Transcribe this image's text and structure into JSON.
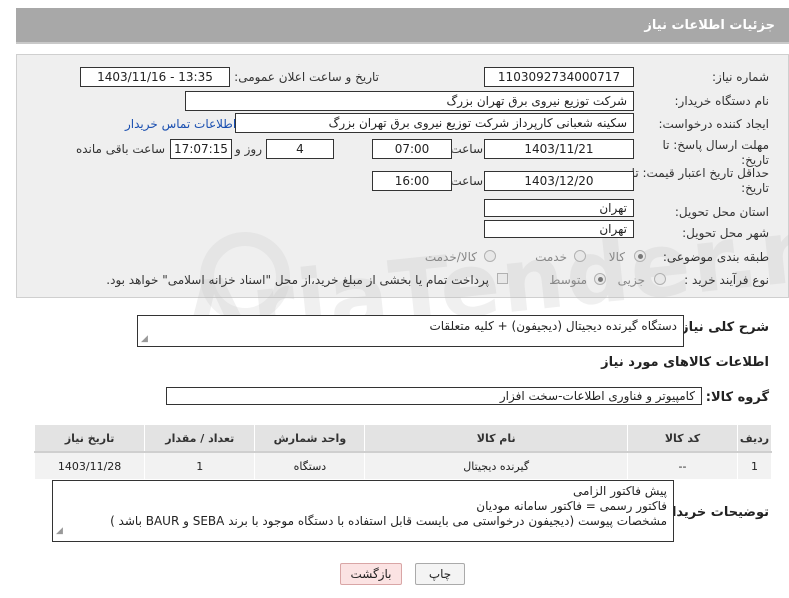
{
  "header": {
    "title": "جزئیات اطلاعات نیاز"
  },
  "form": {
    "need_number": {
      "label": "شماره نیاز:",
      "value": "1103092734000717"
    },
    "announce_datetime": {
      "label": "تاریخ و ساعت اعلان عمومی:",
      "value": "1403/11/16 - 13:35"
    },
    "buyer_org": {
      "label": "نام دستگاه خریدار:",
      "value": "شرکت توزیع نیروی برق تهران بزرگ"
    },
    "requester": {
      "label": "ایجاد کننده درخواست:",
      "value": "سکینه شعبانی کارپرداز شرکت توزیع نیروی برق تهران بزرگ",
      "contact_link": "اطلاعات تماس خریدار"
    },
    "reply_deadline": {
      "label": "مهلت ارسال پاسخ: تا تاریخ:",
      "date": "1403/11/21",
      "time_label": "ساعت",
      "time": "07:00",
      "days": "4",
      "days_label": "روز و",
      "remaining": "17:07:15",
      "remaining_label": "ساعت باقی مانده"
    },
    "price_validity": {
      "label": "حداقل تاریخ اعتبار قیمت: تا تاریخ:",
      "date": "1403/12/20",
      "time_label": "ساعت",
      "time": "16:00"
    },
    "province": {
      "label": "استان محل تحویل:",
      "value": "تهران"
    },
    "city": {
      "label": "شهر محل تحویل:",
      "value": "تهران"
    },
    "category": {
      "label": "طبقه بندی موضوعی:",
      "options": [
        "کالا",
        "خدمت",
        "کالا/خدمت"
      ]
    },
    "purchase_type": {
      "label": "نوع فرآیند خرید :",
      "options": [
        "جزیی",
        "متوسط"
      ],
      "payment_note": "پرداخت تمام یا بخشی از مبلغ خرید،از محل \"اسناد خزانه اسلامی\" خواهد بود."
    }
  },
  "description": {
    "label": "شرح کلی نیاز:",
    "value": "دستگاه گیرنده دیجیتال (دیجیفون) + کلیه متعلقات"
  },
  "goods_section": {
    "title": "اطلاعات کالاهای مورد نیاز",
    "group_label": "گروه کالا:",
    "group_value": "کامپیوتر و فناوری اطلاعات-سخت افزار"
  },
  "table": {
    "headers": [
      "ردیف",
      "کد کالا",
      "نام کالا",
      "واحد شمارش",
      "تعداد / مقدار",
      "تاریخ نیاز"
    ],
    "rows": [
      [
        "1",
        "--",
        "گیرنده دیجیتال",
        "دستگاه",
        "1",
        "1403/11/28"
      ]
    ]
  },
  "buyer_notes": {
    "label": "توضیحات خریدار:",
    "lines": [
      "پیش فاکتور الزامی",
      "فاکتور رسمی = فاکتور سامانه مودیان",
      "مشخصات پیوست (دیجیفون درخواستی می بایست قابل استفاده با دستگاه موجود با برند SEBA  و BAUR باشد )"
    ]
  },
  "buttons": {
    "print": "چاپ",
    "back": "بازگشت"
  },
  "watermark": {
    "text": "AriaTender.net"
  }
}
